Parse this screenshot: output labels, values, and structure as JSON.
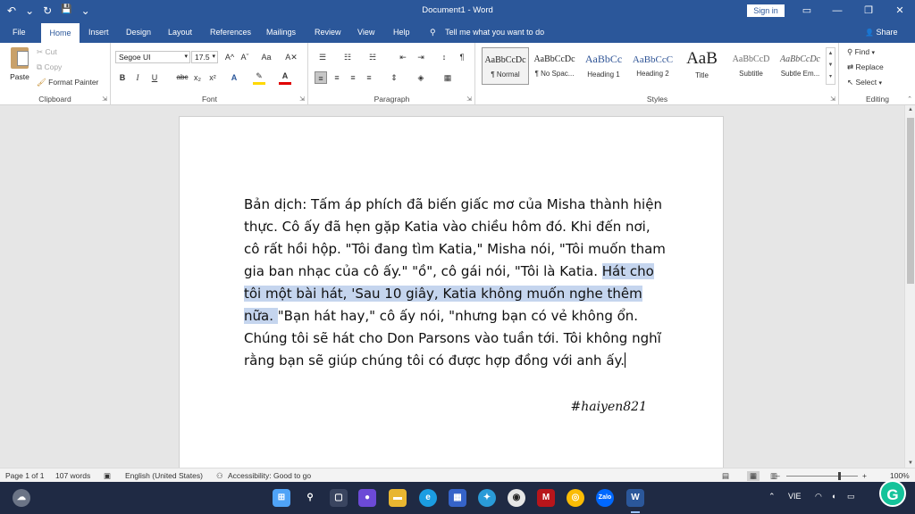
{
  "window": {
    "title": "Document1 - Word",
    "sign_in": "Sign in",
    "minimize_glyph": "—",
    "restore_glyph": "❐",
    "close_glyph": "✕",
    "ribbon_display_glyph": "▭"
  },
  "quick_access": {
    "undo": "↶",
    "undo_menu": "⌄",
    "redo": "↻",
    "save": "💾",
    "customize": "⌄"
  },
  "tabs": [
    "File",
    "Home",
    "Insert",
    "Design",
    "Layout",
    "References",
    "Mailings",
    "Review",
    "View",
    "Help"
  ],
  "active_tab": "Home",
  "tell_me": "Tell me what you want to do",
  "tell_me_icon": "⚲",
  "share": "Share",
  "share_icon": "👤",
  "clipboard": {
    "label": "Clipboard",
    "paste": "Paste",
    "cut": "Cut",
    "copy": "Copy",
    "format_painter": "Format Painter"
  },
  "font": {
    "label": "Font",
    "name": "Segoe UI",
    "size": "17.5",
    "grow": "A^",
    "shrink": "Aˇ",
    "case": "Aa",
    "clear": "A✕",
    "bold": "B",
    "italic": "I",
    "underline": "U",
    "strike": "abc",
    "subscript": "x₂",
    "superscript": "x²",
    "effects": "A",
    "highlight": "✎",
    "color": "A"
  },
  "paragraph": {
    "label": "Paragraph",
    "bullets": "☰",
    "numbering": "☷",
    "multilevel": "☵",
    "decrease_indent": "⇤",
    "increase_indent": "⇥",
    "sort": "↕",
    "pilcrow": "¶",
    "align_left": "≡",
    "center": "≡",
    "align_right": "≡",
    "justify": "≡",
    "line_spacing": "⇕",
    "shading": "◈",
    "borders": "▦"
  },
  "styles": {
    "label": "Styles",
    "items": [
      {
        "preview": "AaBbCcDc",
        "name": "¶ Normal"
      },
      {
        "preview": "AaBbCcDc",
        "name": "¶ No Spac..."
      },
      {
        "preview": "AaBbCc",
        "name": "Heading 1"
      },
      {
        "preview": "AaBbCcC",
        "name": "Heading 2"
      },
      {
        "preview": "AaB",
        "name": "Title"
      },
      {
        "preview": "AaBbCcD",
        "name": "Subtitle"
      },
      {
        "preview": "AaBbCcDc",
        "name": "Subtle Em..."
      }
    ]
  },
  "editing": {
    "label": "Editing",
    "find": "Find",
    "replace": "Replace",
    "select": "Select"
  },
  "document": {
    "text_before": "Bản dịch: Tấm áp phích đã biến giấc mơ của Misha thành hiện thực. Cô ấy đã hẹn gặp Katia vào chiều hôm đó. Khi đến nơi, cô rất hồi hộp. \"Tôi đang tìm Katia,\" Misha nói, \"Tôi muốn tham gia ban nhạc của cô ấy.\" \"ồ\", cô gái nói, \"Tôi là Katia. ",
    "text_selected": "Hát cho tôi một bài hát, 'Sau 10 giây, Katia không muốn nghe thêm nữa. ",
    "text_after": "\"Bạn hát hay,\" cô ấy nói, \"nhưng bạn có vẻ không ổn. Chúng tôi sẽ hát cho Don Parsons vào tuần tới. Tôi không nghĩ rằng bạn sẽ giúp chúng tôi có được hợp đồng với anh ấy.",
    "hashtag": "#haiyen821"
  },
  "status": {
    "page": "Page 1 of 1",
    "words": "107 words",
    "language": "English (United States)",
    "accessibility": "Accessibility: Good to go",
    "zoom": "100%"
  },
  "taskbar": {
    "language": "VIE"
  },
  "colors": {
    "word_blue": "#2b579a",
    "highlight": "#c5d5ee",
    "font_color_bar": "#e00000",
    "highlight_bar": "#ffd800",
    "grammarly": "#15c39a"
  }
}
